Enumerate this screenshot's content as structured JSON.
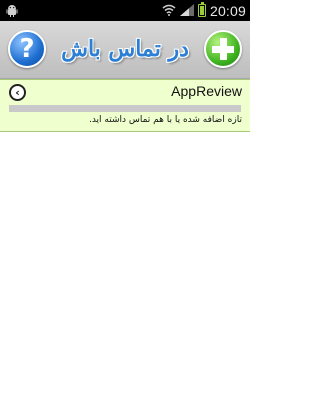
{
  "status_bar": {
    "time": "20:09",
    "icons": [
      "android-icon",
      "wifi-icon",
      "signal-icon",
      "battery-icon"
    ],
    "battery_color": "#9ccc3a"
  },
  "header": {
    "title": "در تماس باش",
    "help_symbol": "?",
    "add_icon": "plus-icon",
    "title_color": "#2b7fd4"
  },
  "list": {
    "items": [
      {
        "name": "AppReview",
        "status": "تازه اضافه شده یا با هم تماس داشته اید.",
        "progress": 0,
        "background": "#efffce"
      }
    ]
  }
}
